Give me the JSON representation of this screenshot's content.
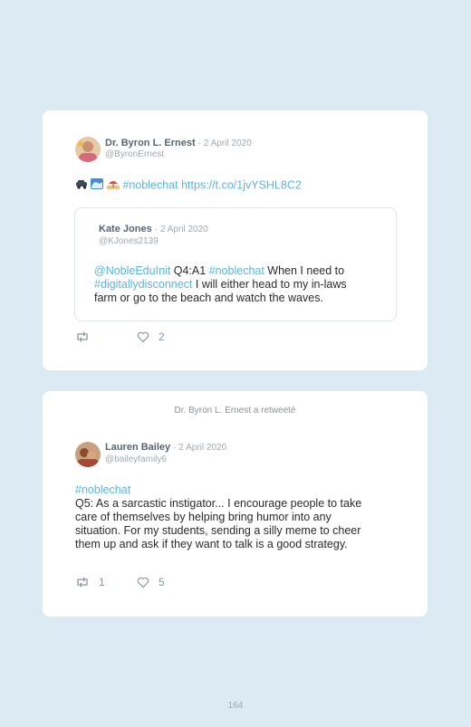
{
  "tweet1": {
    "author": "Dr. Byron L. Ernest",
    "date": "· 2 April 2020",
    "handle": "@ByronErnest",
    "hashtag": "#noblechat",
    "url": "https://t.co/1jvYSHL8C2",
    "emojis": [
      "car-emoji",
      "wave-emoji",
      "beach-emoji"
    ],
    "likes": "2",
    "quoted": {
      "author": "Kate Jones",
      "date": "· 2 April 2020",
      "handle": "@KJones2139",
      "mention": "@NobleEduInit",
      "text_a": " Q4:A1 ",
      "hashtag1": "#noblechat",
      "text_b": " When I need to",
      "hashtag2": "#digitallydisconnect",
      "text_c": " I will either head to my in-laws",
      "text_d": "farm or go to the beach and watch the waves."
    }
  },
  "tweet2": {
    "retweet_note": "Dr. Byron L. Ernest a retweeté",
    "author": "Lauren Bailey",
    "date": "· 2 April 2020",
    "handle": "@baileyfamily6",
    "hashtag": "#noblechat",
    "line1": "Q5: As a sarcastic instigator... I encourage people to take",
    "line2": "care of themselves by helping bring humor into any",
    "line3": "situation. For my students, sending a silly meme to cheer",
    "line4": "them up and ask if they want to talk is a good strategy.",
    "retweets": "1",
    "likes": "5"
  },
  "page_number": "164",
  "colors": {
    "background": "#dceaf4",
    "link": "#58b5e6",
    "card": "#ffffff"
  }
}
